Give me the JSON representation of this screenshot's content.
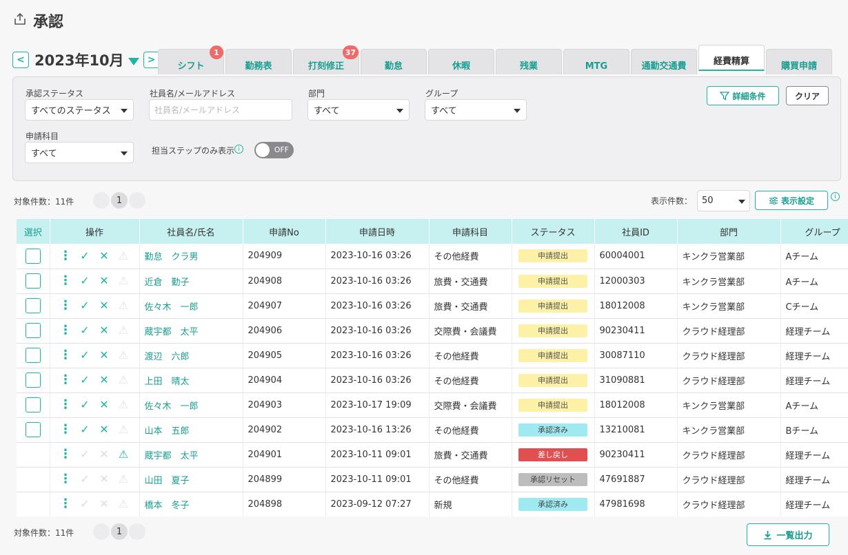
{
  "page": {
    "title": "承認"
  },
  "month": {
    "label": "2023年10月",
    "prev": "<",
    "next": ">"
  },
  "tabs": [
    {
      "label": "シフト",
      "badge": "1"
    },
    {
      "label": "勤務表"
    },
    {
      "label": "打刻修正",
      "badge": "37"
    },
    {
      "label": "勤怠"
    },
    {
      "label": "休暇"
    },
    {
      "label": "残業"
    },
    {
      "label": "MTG"
    },
    {
      "label": "通勤交通費"
    },
    {
      "label": "経費精算",
      "active": true
    },
    {
      "label": "購買申請"
    }
  ],
  "filters": {
    "status_label": "承認ステータス",
    "status_value": "すべてのステータス",
    "employee_label": "社員名/メールアドレス",
    "employee_placeholder": "社員名/メールアドレス",
    "dept_label": "部門",
    "dept_value": "すべて",
    "group_label": "グループ",
    "group_value": "すべて",
    "item_label": "申請科目",
    "item_value": "すべて",
    "step_only_label": "担当ステップのみ表示",
    "toggle_state": "OFF",
    "detail_button": "詳細条件",
    "clear_button": "クリア"
  },
  "summary": {
    "count_text": "対象件数：11件",
    "page": "1",
    "per_page_label": "表示件数：",
    "per_page_value": "50",
    "settings_button": "表示設定",
    "export_button": "一覧出力"
  },
  "table": {
    "headers": [
      "選択",
      "操作",
      "社員名/氏名",
      "申請No",
      "申請日時",
      "申請科目",
      "ステータス",
      "社員ID",
      "部門",
      "グループ"
    ],
    "rows": [
      {
        "selectable": true,
        "name": "勤怠　クラ男",
        "no": "204909",
        "date": "2023-10-16 03:26",
        "item": "その他経費",
        "status": "申請提出",
        "status_type": "pending",
        "emp_id": "60004001",
        "dept": "キンクラ営業部",
        "group": "Aチーム"
      },
      {
        "selectable": true,
        "name": "近倉　勤子",
        "no": "204908",
        "date": "2023-10-16 03:26",
        "item": "旅費・交通費",
        "status": "申請提出",
        "status_type": "pending",
        "emp_id": "12000303",
        "dept": "キンクラ営業部",
        "group": "Aチーム"
      },
      {
        "selectable": true,
        "name": "佐々木　一郎",
        "no": "204907",
        "date": "2023-10-16 03:26",
        "item": "旅費・交通費",
        "status": "申請提出",
        "status_type": "pending",
        "emp_id": "18012008",
        "dept": "キンクラ営業部",
        "group": "Cチーム"
      },
      {
        "selectable": true,
        "name": "蔵宇都　太平",
        "no": "204906",
        "date": "2023-10-16 03:26",
        "item": "交際費・会議費",
        "status": "申請提出",
        "status_type": "pending",
        "emp_id": "90230411",
        "dept": "クラウド経理部",
        "group": "経理チーム"
      },
      {
        "selectable": true,
        "name": "渡辺　六郎",
        "no": "204905",
        "date": "2023-10-16 03:26",
        "item": "その他経費",
        "status": "申請提出",
        "status_type": "pending",
        "emp_id": "30087110",
        "dept": "クラウド経理部",
        "group": "経理チーム"
      },
      {
        "selectable": true,
        "name": "上田　晴太",
        "no": "204904",
        "date": "2023-10-16 03:26",
        "item": "その他経費",
        "status": "申請提出",
        "status_type": "pending",
        "emp_id": "31090881",
        "dept": "クラウド経理部",
        "group": "経理チーム"
      },
      {
        "selectable": true,
        "name": "佐々木　一郎",
        "no": "204903",
        "date": "2023-10-17 19:09",
        "item": "交際費・会議費",
        "status": "申請提出",
        "status_type": "pending",
        "emp_id": "18012008",
        "dept": "キンクラ営業部",
        "group": "Aチーム"
      },
      {
        "selectable": true,
        "name": "山本　五郎",
        "no": "204902",
        "date": "2023-10-16 13:26",
        "item": "その他経費",
        "status": "承認済み",
        "status_type": "approved",
        "emp_id": "13210081",
        "dept": "キンクラ営業部",
        "group": "Bチーム"
      },
      {
        "selectable": false,
        "warn": true,
        "name": "蔵宇都　太平",
        "no": "204901",
        "date": "2023-10-11 09:01",
        "item": "旅費・交通費",
        "status": "差し戻し",
        "status_type": "returned",
        "emp_id": "90230411",
        "dept": "クラウド経理部",
        "group": "経理チーム"
      },
      {
        "selectable": false,
        "name": "山田　夏子",
        "no": "204899",
        "date": "2023-10-11 09:01",
        "item": "その他経費",
        "status": "承認リセット",
        "status_type": "reset",
        "emp_id": "47691887",
        "dept": "クラウド経理部",
        "group": "経理チーム"
      },
      {
        "selectable": false,
        "name": "橋本　冬子",
        "no": "204898",
        "date": "2023-09-12 07:27",
        "item": "新規",
        "status": "承認済み",
        "status_type": "approved",
        "emp_id": "47981698",
        "dept": "クラウド経理部",
        "group": "経理チーム"
      }
    ]
  },
  "colors": {
    "accent": "#1fb5a4",
    "header_bg": "#c7f0f0",
    "badge": "#ef6b6b"
  },
  "icons": {
    "header": "share-icon",
    "filter": "filter-icon",
    "settings": "sliders-icon",
    "export": "download-icon"
  }
}
